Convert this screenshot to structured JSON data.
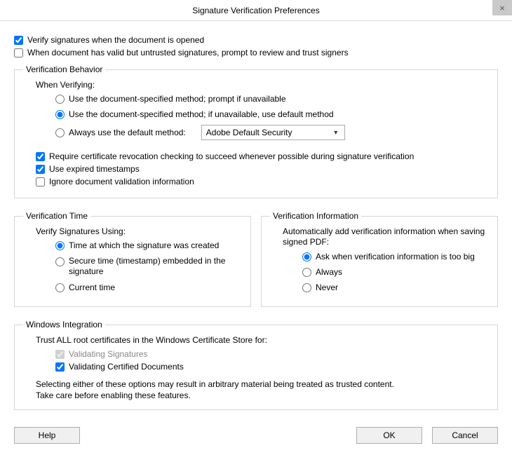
{
  "title": "Signature Verification Preferences",
  "close_icon": "×",
  "top": {
    "verify_on_open": "Verify signatures when the document is opened",
    "prompt_untrusted": "When document has valid but untrusted signatures, prompt to review and trust signers"
  },
  "behavior": {
    "legend": "Verification Behavior",
    "when_verifying": "When Verifying:",
    "opt1": "Use the document-specified method; prompt if unavailable",
    "opt2": "Use the document-specified method; if unavailable, use default method",
    "opt3": "Always use the default method:",
    "select_value": "Adobe Default Security",
    "require_revocation": "Require certificate revocation checking to succeed whenever possible during signature verification",
    "use_expired_ts": "Use expired timestamps",
    "ignore_doc_validation": "Ignore document validation information"
  },
  "time": {
    "legend": "Verification Time",
    "heading": "Verify Signatures Using:",
    "opt1": "Time at which the signature was created",
    "opt2": "Secure time (timestamp) embedded in the signature",
    "opt3": "Current time"
  },
  "info": {
    "legend": "Verification Information",
    "heading": "Automatically add verification information when saving signed PDF:",
    "opt1": "Ask when verification information is too big",
    "opt2": "Always",
    "opt3": "Never"
  },
  "win": {
    "legend": "Windows Integration",
    "heading": "Trust ALL root certificates in the Windows Certificate Store for:",
    "validating_sigs": "Validating Signatures",
    "validating_docs": "Validating Certified Documents",
    "note1": "Selecting either of these options may result in arbitrary material being treated as trusted content.",
    "note2": "Take care before enabling these features."
  },
  "buttons": {
    "help": "Help",
    "ok": "OK",
    "cancel": "Cancel"
  }
}
